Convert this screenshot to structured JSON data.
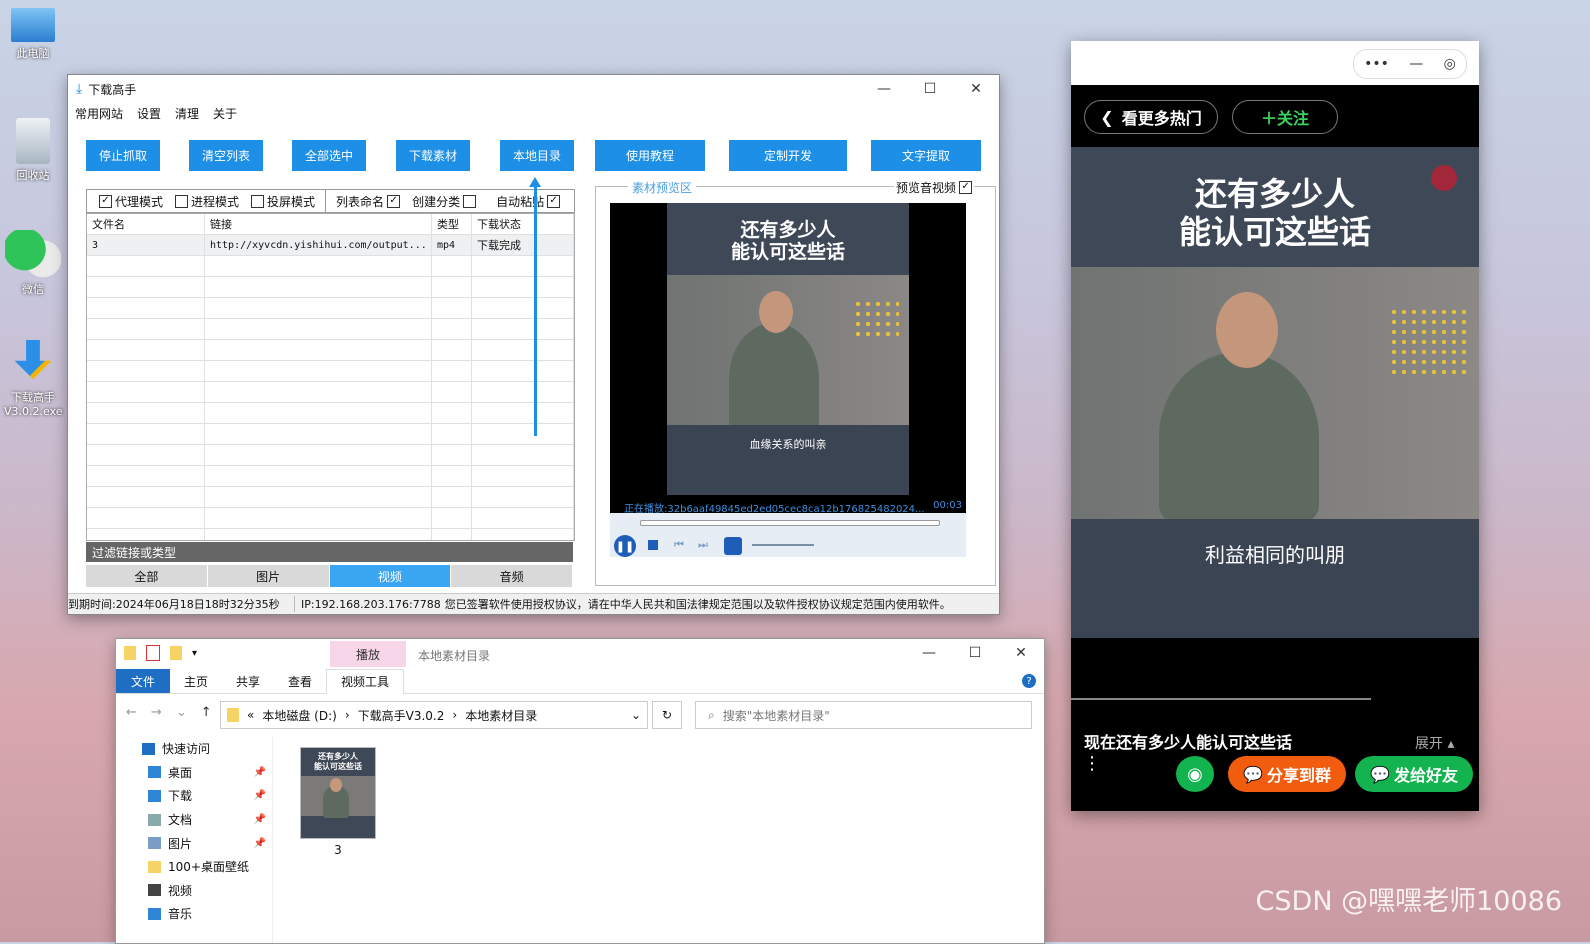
{
  "desktop": {
    "icons": [
      {
        "label": "此电脑"
      },
      {
        "label": "回收站"
      },
      {
        "label": "微信"
      },
      {
        "label": "下载高手\nV3.0.2.exe"
      }
    ]
  },
  "main_window": {
    "title": "下载高手",
    "menu": [
      "常用网站",
      "设置",
      "清理",
      "关于"
    ],
    "toolbar": [
      "停止抓取",
      "清空列表",
      "全部选中",
      "下载素材",
      "本地目录",
      "使用教程",
      "定制开发",
      "文字提取"
    ],
    "options": [
      {
        "label": "代理模式",
        "checked": true
      },
      {
        "label": "进程模式",
        "checked": false
      },
      {
        "label": "投屏模式",
        "checked": false
      },
      {
        "label": "列表命名",
        "checked": true
      },
      {
        "label": "创建分类",
        "checked": false
      },
      {
        "label": "自动粘贴",
        "checked": true
      }
    ],
    "table": {
      "columns": [
        "文件名",
        "链接",
        "类型",
        "下载状态"
      ],
      "rows": [
        [
          "3",
          "http://xyvcdn.yishihui.com/output...",
          "mp4",
          "下载完成"
        ]
      ]
    },
    "filter_label": "过滤链接或类型",
    "filter_tabs": [
      "全部",
      "图片",
      "视频",
      "音频"
    ],
    "filter_active": "视频",
    "preview": {
      "group_label": "素材预览区",
      "preview_av_label": "预览音视频",
      "preview_av_checked": true,
      "video_title": "还有多少人\n能认可这些话",
      "subtitle": "血缘关系的叫亲",
      "now_playing": "正在播放:32b6aaf49845ed2ed05cec8ca12b176825482024...",
      "time": "00:03"
    },
    "status": {
      "expire": "到期时间:2024年06月18日18时32分35秒",
      "ip": "IP:192.168.203.176:7788",
      "notice": "您已签署软件使用授权协议，请在中华人民共和国法律规定范围以及软件授权协议规定范围内使用软件。"
    }
  },
  "explorer": {
    "ribbon_context": "播放",
    "window_title": "本地素材目录",
    "tabs": [
      "文件",
      "主页",
      "共享",
      "查看",
      "视频工具"
    ],
    "breadcrumb": [
      "本地磁盘 (D:)",
      "下载高手V3.0.2",
      "本地素材目录"
    ],
    "search_placeholder": "搜索\"本地素材目录\"",
    "nav": [
      {
        "label": "快速访问",
        "pinned": false
      },
      {
        "label": "桌面",
        "pinned": true
      },
      {
        "label": "下载",
        "pinned": true
      },
      {
        "label": "文档",
        "pinned": true
      },
      {
        "label": "图片",
        "pinned": true
      },
      {
        "label": "100+桌面壁纸",
        "pinned": false
      },
      {
        "label": "视频",
        "pinned": false
      },
      {
        "label": "音乐",
        "pinned": false
      }
    ],
    "files": [
      {
        "name": "3",
        "thumb_title": "还有多少人\n能认可这些话"
      }
    ]
  },
  "mini_program": {
    "back_label": "看更多热门",
    "follow_label": "＋关注",
    "video_title": "还有多少人\n能认可这些话",
    "subtitle": "利益相同的叫朋",
    "caption": "现在还有多少人能认可这些话",
    "expand_label": "展开",
    "share_group": "分享到群",
    "share_friend": "发给好友"
  },
  "watermark": "CSDN @嘿嘿老师10086",
  "colors": {
    "accent": "#1e8fe6",
    "share_group": "#f25c0f",
    "share_friend": "#13b34f"
  }
}
